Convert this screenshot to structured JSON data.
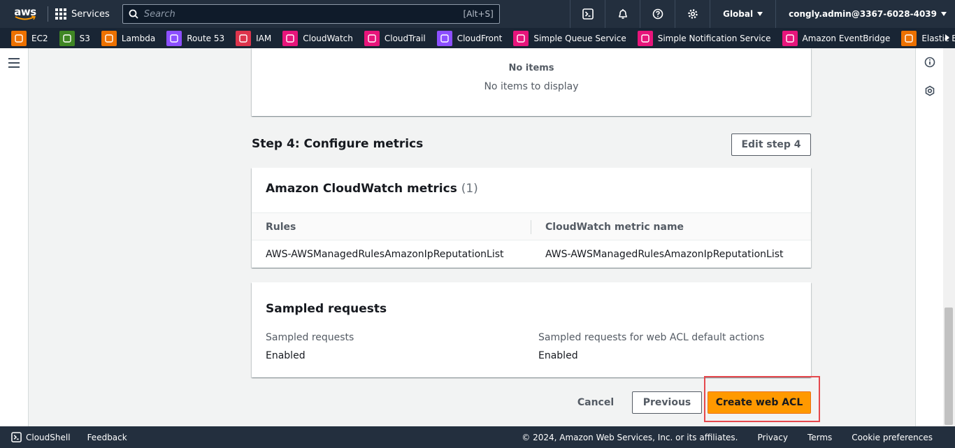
{
  "topnav": {
    "logo": "aws",
    "services_label": "Services",
    "search_placeholder": "Search",
    "search_shortcut": "[Alt+S]",
    "region": "Global",
    "user": "congly.admin@3367-6028-4039"
  },
  "favorites": [
    {
      "label": "EC2",
      "color": "#ed7100",
      "icon": "ec2-icon"
    },
    {
      "label": "S3",
      "color": "#3f8624",
      "icon": "s3-icon"
    },
    {
      "label": "Lambda",
      "color": "#ed7100",
      "icon": "lambda-icon"
    },
    {
      "label": "Route 53",
      "color": "#8c4fff",
      "icon": "route53-icon"
    },
    {
      "label": "IAM",
      "color": "#dd344c",
      "icon": "iam-icon"
    },
    {
      "label": "CloudWatch",
      "color": "#e7157b",
      "icon": "cloudwatch-icon"
    },
    {
      "label": "CloudTrail",
      "color": "#e7157b",
      "icon": "cloudtrail-icon"
    },
    {
      "label": "CloudFront",
      "color": "#8c4fff",
      "icon": "cloudfront-icon"
    },
    {
      "label": "Simple Queue Service",
      "color": "#e7157b",
      "icon": "sqs-icon"
    },
    {
      "label": "Simple Notification Service",
      "color": "#e7157b",
      "icon": "sns-icon"
    },
    {
      "label": "Amazon EventBridge",
      "color": "#e7157b",
      "icon": "eventbridge-icon"
    },
    {
      "label": "Elastic Beans",
      "color": "#ed7100",
      "icon": "beanstalk-icon"
    }
  ],
  "empty_table": {
    "title": "No items",
    "subtitle": "No items to display"
  },
  "step4": {
    "title": "Step 4: Configure metrics",
    "edit_label": "Edit step 4"
  },
  "metrics": {
    "title": "Amazon CloudWatch metrics",
    "count": "(1)",
    "columns": [
      "Rules",
      "CloudWatch metric name"
    ],
    "rows": [
      [
        "AWS-AWSManagedRulesAmazonIpReputationList",
        "AWS-AWSManagedRulesAmazonIpReputationList"
      ]
    ]
  },
  "sampled": {
    "title": "Sampled requests",
    "label1": "Sampled requests",
    "value1": "Enabled",
    "label2": "Sampled requests for web ACL default actions",
    "value2": "Enabled"
  },
  "actions": {
    "cancel": "Cancel",
    "previous": "Previous",
    "create": "Create web ACL"
  },
  "footer": {
    "cloudshell": "CloudShell",
    "feedback": "Feedback",
    "copyright": "© 2024, Amazon Web Services, Inc. or its affiliates.",
    "privacy": "Privacy",
    "terms": "Terms",
    "cookies": "Cookie preferences"
  }
}
